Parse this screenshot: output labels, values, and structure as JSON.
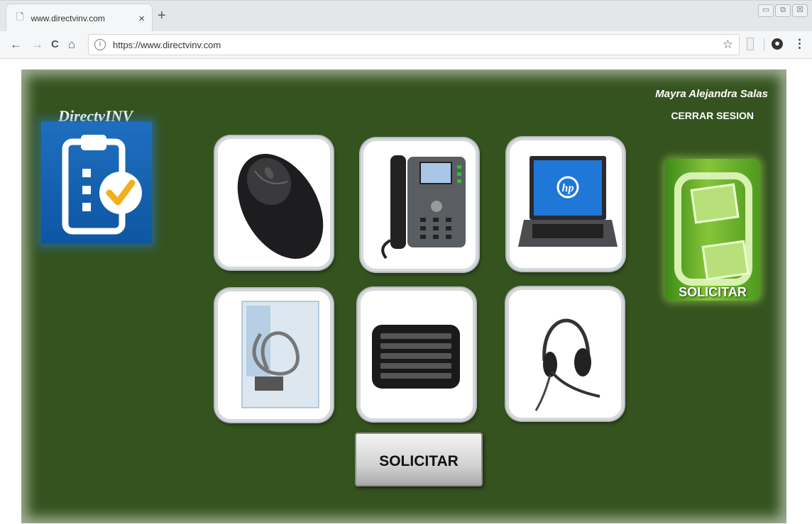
{
  "browser": {
    "tab_title": "www.directvinv.com",
    "tab_close": "×",
    "new_tab": "+",
    "url": "https://www.directvinv.com",
    "nav": {
      "back": "←",
      "forward": "→",
      "reload": "C",
      "home": "⌂"
    },
    "star": "☆",
    "menu": "⋮",
    "window_controls": [
      "▭",
      "⧉",
      "☒"
    ]
  },
  "app": {
    "brand": "DirectvINV",
    "user_name": "Mayra Alejandra Salas",
    "logout_label": "CERRAR SESION",
    "solicitar_tile_label": "SOLICITAR",
    "solicitar_button_label": "SOLICITAR",
    "accent_color": "#35531f",
    "items": [
      {
        "name": "mouse",
        "icon": "mouse-image"
      },
      {
        "name": "telephone",
        "icon": "ip-phone-image"
      },
      {
        "name": "laptop",
        "icon": "laptop-image",
        "logo_text": "hp"
      },
      {
        "name": "security cable lock",
        "icon": "cable-lock-image"
      },
      {
        "name": "keyboard",
        "icon": "keyboard-image"
      },
      {
        "name": "headset",
        "icon": "headset-image"
      }
    ]
  }
}
